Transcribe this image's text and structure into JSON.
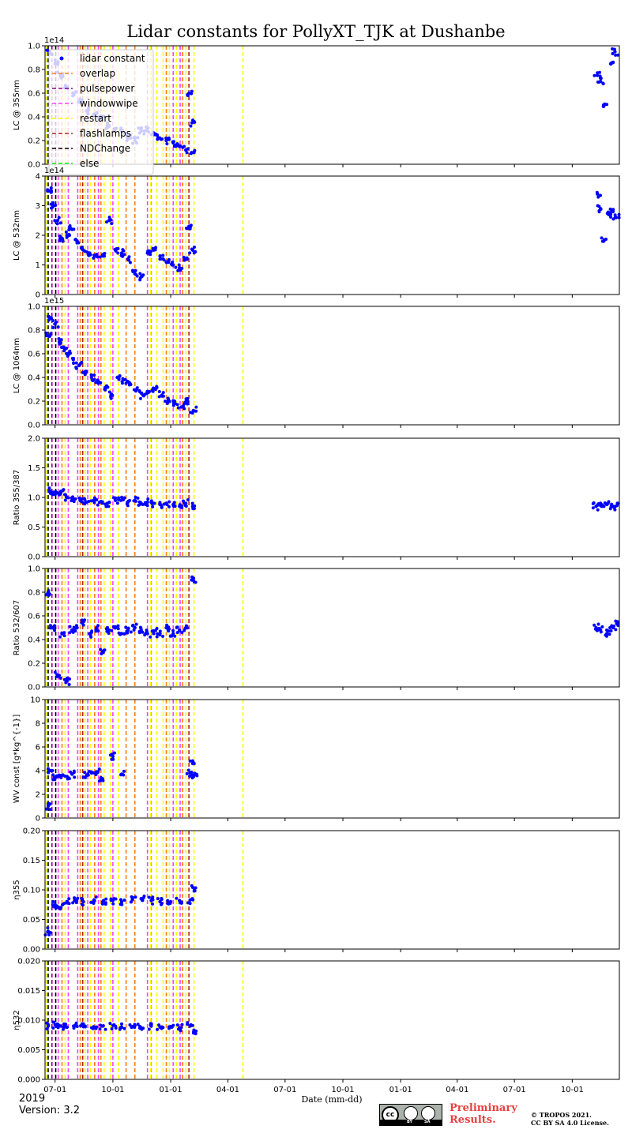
{
  "title": "Lidar constants for PollyXT_TJK at Dushanbe",
  "xlabel": "Date (mm-dd)",
  "footer": {
    "year": "2019",
    "version": "Version: 3.2",
    "preliminary_line1": "Preliminary",
    "preliminary_line2": "Results.",
    "copyright_line1": "© TROPOS 2021.",
    "copyright_line2": "CC BY SA 4.0 License.",
    "license_badge": {
      "main": "cc",
      "by": "BY",
      "sa": "SA"
    }
  },
  "colors": {
    "data": "#0000ff",
    "overlap": "#ff7f0e",
    "pulsepower": "#8b0088",
    "windowwipe": "#ff40ff",
    "restart": "#ffff00",
    "flashlamps": "#b22222",
    "NDChange": "#000000",
    "else": "#00ff00"
  },
  "chart_data": {
    "type": "scatter",
    "x_axis": {
      "type": "date",
      "range": [
        "2019-06-15",
        "2021-12-15"
      ],
      "ticks": [
        "2019-07-01",
        "2019-10-01",
        "2020-01-01",
        "2020-04-01",
        "2020-07-01",
        "2020-10-01",
        "2021-01-01",
        "2021-04-01",
        "2021-07-01",
        "2021-10-01"
      ],
      "tick_labels": [
        "07-01",
        "10-01",
        "01-01",
        "04-01",
        "07-01",
        "10-01",
        "01-01",
        "04-01",
        "07-01",
        "10-01"
      ]
    },
    "legend": {
      "placement": "upper-left of first panel",
      "entries": [
        "lidar constant",
        "overlap",
        "pulsepower",
        "windowwipe",
        "restart",
        "flashlamps",
        "NDChange",
        "else"
      ]
    },
    "events": {
      "NDChange": [
        "2019-06-20",
        "2019-07-02"
      ],
      "overlap": [
        "2019-07-12",
        "2019-08-10",
        "2019-09-02",
        "2019-09-12",
        "2019-10-22",
        "2019-11-05",
        "2019-12-01",
        "2019-12-25",
        "2020-01-20"
      ],
      "pulsepower": [
        "2019-06-26"
      ],
      "windowwipe": [
        "2019-07-06",
        "2019-07-22",
        "2019-08-06",
        "2019-08-22",
        "2019-09-08",
        "2019-10-01",
        "2019-11-25",
        "2020-01-05",
        "2020-01-16"
      ],
      "restart": [
        "2019-06-17",
        "2019-07-17",
        "2019-08-18",
        "2019-08-26",
        "2019-09-17",
        "2019-09-27",
        "2019-10-10",
        "2019-11-30",
        "2019-12-10",
        "2019-12-20",
        "2019-12-30",
        "2020-01-10",
        "2020-01-25",
        "2020-02-07",
        "2020-04-25"
      ],
      "flashlamps": [
        "2019-08-14",
        "2020-01-30"
      ]
    },
    "panels": [
      {
        "ylabel": "LC @ 355nm",
        "ylim": [
          0,
          1.0
        ],
        "offset": "1e14",
        "show_legend": true,
        "yticks": [
          0.0,
          0.2,
          0.4,
          0.6,
          0.8,
          1.0
        ],
        "ytick_labels": [
          "0.0",
          "0.2",
          "0.4",
          "0.6",
          "0.8",
          "1.0"
        ],
        "x": [
          "2019-06-22",
          "2019-07-01",
          "2019-07-10",
          "2019-07-20",
          "2019-07-30",
          "2019-08-10",
          "2019-08-20",
          "2019-09-01",
          "2019-09-12",
          "2019-09-22",
          "2019-10-05",
          "2019-10-15",
          "2019-10-25",
          "2019-11-05",
          "2019-11-15",
          "2019-11-25",
          "2019-12-05",
          "2019-12-15",
          "2019-12-25",
          "2020-01-05",
          "2020-01-15",
          "2020-01-25",
          "2020-01-30",
          "2020-02-04",
          "2020-02-07",
          "2021-11-10",
          "2021-11-15",
          "2021-11-20",
          "2021-12-02",
          "2021-12-08"
        ],
        "y": [
          0.95,
          0.85,
          0.75,
          0.65,
          0.6,
          0.55,
          0.45,
          0.42,
          0.38,
          0.33,
          0.3,
          0.28,
          0.22,
          0.2,
          0.28,
          0.3,
          0.25,
          0.22,
          0.2,
          0.18,
          0.15,
          0.12,
          0.6,
          0.35,
          0.1,
          0.75,
          0.7,
          0.5,
          0.85,
          0.95
        ]
      },
      {
        "ylabel": "LC @ 532nm",
        "ylim": [
          0,
          4
        ],
        "offset": "1e14",
        "show_legend": false,
        "yticks": [
          0,
          1,
          2,
          3,
          4
        ],
        "ytick_labels": [
          "0",
          "1",
          "2",
          "3",
          "4"
        ],
        "x": [
          "2019-06-22",
          "2019-06-28",
          "2019-07-05",
          "2019-07-12",
          "2019-07-20",
          "2019-07-28",
          "2019-08-05",
          "2019-08-15",
          "2019-08-25",
          "2019-09-05",
          "2019-09-15",
          "2019-09-25",
          "2019-10-05",
          "2019-10-15",
          "2019-10-25",
          "2019-11-05",
          "2019-11-15",
          "2019-11-25",
          "2019-12-05",
          "2019-12-15",
          "2019-12-25",
          "2020-01-05",
          "2020-01-15",
          "2020-01-25",
          "2020-01-30",
          "2020-02-05",
          "2021-11-10",
          "2021-11-15",
          "2021-11-20",
          "2021-11-28",
          "2021-12-05",
          "2021-12-10"
        ],
        "y": [
          3.5,
          3.0,
          2.5,
          1.9,
          2.0,
          2.2,
          1.8,
          1.5,
          1.4,
          1.3,
          1.3,
          2.5,
          1.5,
          1.4,
          1.2,
          0.7,
          0.6,
          1.4,
          1.5,
          1.3,
          1.1,
          1.0,
          0.9,
          1.2,
          2.3,
          1.5,
          3.4,
          2.9,
          1.8,
          2.7,
          2.8,
          2.6
        ]
      },
      {
        "ylabel": "LC @ 1064nm",
        "ylim": [
          0,
          1.0
        ],
        "offset": "1e15",
        "show_legend": false,
        "yticks": [
          0.0,
          0.2,
          0.4,
          0.6,
          0.8,
          1.0
        ],
        "ytick_labels": [
          "0.0",
          "0.2",
          "0.4",
          "0.6",
          "0.8",
          "1.0"
        ],
        "x": [
          "2019-06-20",
          "2019-06-25",
          "2019-07-01",
          "2019-07-08",
          "2019-07-15",
          "2019-07-22",
          "2019-07-30",
          "2019-08-08",
          "2019-08-18",
          "2019-08-28",
          "2019-09-08",
          "2019-09-18",
          "2019-09-28",
          "2019-10-08",
          "2019-10-18",
          "2019-10-28",
          "2019-11-08",
          "2019-11-18",
          "2019-11-28",
          "2019-12-08",
          "2019-12-18",
          "2019-12-28",
          "2020-01-08",
          "2020-01-18",
          "2020-01-28",
          "2020-02-06"
        ],
        "y": [
          0.75,
          0.9,
          0.85,
          0.7,
          0.65,
          0.6,
          0.55,
          0.5,
          0.45,
          0.4,
          0.35,
          0.3,
          0.25,
          0.4,
          0.38,
          0.35,
          0.3,
          0.25,
          0.28,
          0.3,
          0.25,
          0.2,
          0.18,
          0.15,
          0.2,
          0.12
        ]
      },
      {
        "ylabel": "Ratio 355/387",
        "ylim": [
          0,
          2.0
        ],
        "offset": "",
        "show_legend": false,
        "yticks": [
          0.0,
          0.5,
          1.0,
          1.5,
          2.0
        ],
        "ytick_labels": [
          "0.0",
          "0.5",
          "1.0",
          "1.5",
          "2.0"
        ],
        "x": [
          "2019-06-22",
          "2019-07-01",
          "2019-07-10",
          "2019-07-20",
          "2019-07-30",
          "2019-08-10",
          "2019-08-20",
          "2019-09-01",
          "2019-09-12",
          "2019-09-22",
          "2019-10-05",
          "2019-10-15",
          "2019-10-25",
          "2019-11-05",
          "2019-11-15",
          "2019-11-25",
          "2019-12-05",
          "2019-12-15",
          "2019-12-25",
          "2020-01-05",
          "2020-01-15",
          "2020-01-25",
          "2020-02-05",
          "2021-11-08",
          "2021-11-15",
          "2021-11-25",
          "2021-12-05",
          "2021-12-12"
        ],
        "y": [
          1.1,
          1.05,
          1.1,
          1.0,
          0.98,
          0.95,
          0.92,
          0.95,
          0.93,
          0.9,
          0.95,
          1.0,
          0.92,
          0.95,
          0.9,
          0.92,
          0.9,
          0.88,
          0.9,
          0.88,
          0.85,
          0.9,
          0.85,
          0.85,
          0.9,
          0.88,
          0.85,
          0.9
        ]
      },
      {
        "ylabel": "Ratio 532/607",
        "ylim": [
          0,
          1.0
        ],
        "offset": "",
        "show_legend": false,
        "yticks": [
          0.0,
          0.2,
          0.4,
          0.6,
          0.8,
          1.0
        ],
        "ytick_labels": [
          "0.0",
          "0.2",
          "0.4",
          "0.6",
          "0.8",
          "1.0"
        ],
        "x": [
          "2019-06-20",
          "2019-06-28",
          "2019-07-05",
          "2019-07-12",
          "2019-07-20",
          "2019-07-28",
          "2019-08-05",
          "2019-08-15",
          "2019-08-25",
          "2019-09-05",
          "2019-09-15",
          "2019-09-25",
          "2019-10-05",
          "2019-10-15",
          "2019-10-25",
          "2019-11-05",
          "2019-11-15",
          "2019-11-25",
          "2019-12-05",
          "2019-12-15",
          "2019-12-25",
          "2020-01-05",
          "2020-01-15",
          "2020-01-25",
          "2020-02-06",
          "2021-11-08",
          "2021-11-15",
          "2021-11-25",
          "2021-12-05",
          "2021-12-12"
        ],
        "y": [
          0.8,
          0.5,
          0.1,
          0.45,
          0.05,
          0.48,
          0.5,
          0.55,
          0.45,
          0.5,
          0.3,
          0.48,
          0.5,
          0.45,
          0.48,
          0.5,
          0.48,
          0.45,
          0.47,
          0.45,
          0.5,
          0.45,
          0.48,
          0.5,
          0.9,
          0.5,
          0.48,
          0.45,
          0.5,
          0.55
        ]
      },
      {
        "ylabel": "WV const [g*kg^{-1}]",
        "ylim": [
          0,
          10
        ],
        "offset": "",
        "show_legend": false,
        "yticks": [
          0,
          2,
          4,
          6,
          8,
          10
        ],
        "ytick_labels": [
          "0",
          "2",
          "4",
          "6",
          "8",
          "10"
        ],
        "x": [
          "2019-06-20",
          "2019-06-24",
          "2019-06-30",
          "2019-07-05",
          "2019-07-12",
          "2019-07-20",
          "2019-07-28",
          "2019-08-20",
          "2019-08-28",
          "2019-09-05",
          "2019-09-12",
          "2019-10-01",
          "2019-10-15",
          "2020-02-01",
          "2020-02-05",
          "2020-02-07"
        ],
        "y": [
          1.0,
          4.0,
          3.4,
          3.5,
          3.6,
          3.5,
          3.7,
          3.6,
          3.8,
          3.9,
          3.4,
          5.2,
          3.7,
          3.8,
          4.6,
          3.6
        ]
      },
      {
        "ylabel": "η355",
        "ylim": [
          0,
          0.2
        ],
        "offset": "",
        "show_legend": false,
        "yticks": [
          0.0,
          0.05,
          0.1,
          0.15,
          0.2
        ],
        "ytick_labels": [
          "0.00",
          "0.05",
          "0.10",
          "0.15",
          "0.20"
        ],
        "x": [
          "2019-06-20",
          "2019-07-01",
          "2019-07-10",
          "2019-07-20",
          "2019-08-01",
          "2019-08-15",
          "2019-09-01",
          "2019-09-15",
          "2019-10-01",
          "2019-10-15",
          "2019-11-01",
          "2019-11-15",
          "2019-12-01",
          "2019-12-15",
          "2020-01-01",
          "2020-01-15",
          "2020-02-01",
          "2020-02-07"
        ],
        "y": [
          0.03,
          0.075,
          0.07,
          0.08,
          0.082,
          0.08,
          0.083,
          0.08,
          0.082,
          0.08,
          0.083,
          0.085,
          0.082,
          0.08,
          0.08,
          0.082,
          0.083,
          0.103
        ]
      },
      {
        "ylabel": "η532",
        "ylim": [
          0,
          0.02
        ],
        "offset": "",
        "show_legend": false,
        "yticks": [
          0.0,
          0.005,
          0.01,
          0.015,
          0.02
        ],
        "ytick_labels": [
          "0.000",
          "0.005",
          "0.010",
          "0.015",
          "0.020"
        ],
        "x": [
          "2019-06-20",
          "2019-07-01",
          "2019-07-10",
          "2019-07-20",
          "2019-08-01",
          "2019-08-15",
          "2019-09-01",
          "2019-09-15",
          "2019-10-01",
          "2019-10-15",
          "2019-11-01",
          "2019-11-15",
          "2019-12-01",
          "2019-12-15",
          "2020-01-01",
          "2020-01-15",
          "2020-02-01",
          "2020-02-07"
        ],
        "y": [
          0.009,
          0.0092,
          0.009,
          0.0088,
          0.009,
          0.0089,
          0.0087,
          0.009,
          0.0091,
          0.0088,
          0.0089,
          0.0087,
          0.009,
          0.0088,
          0.0089,
          0.0087,
          0.009,
          0.0083
        ]
      }
    ]
  }
}
